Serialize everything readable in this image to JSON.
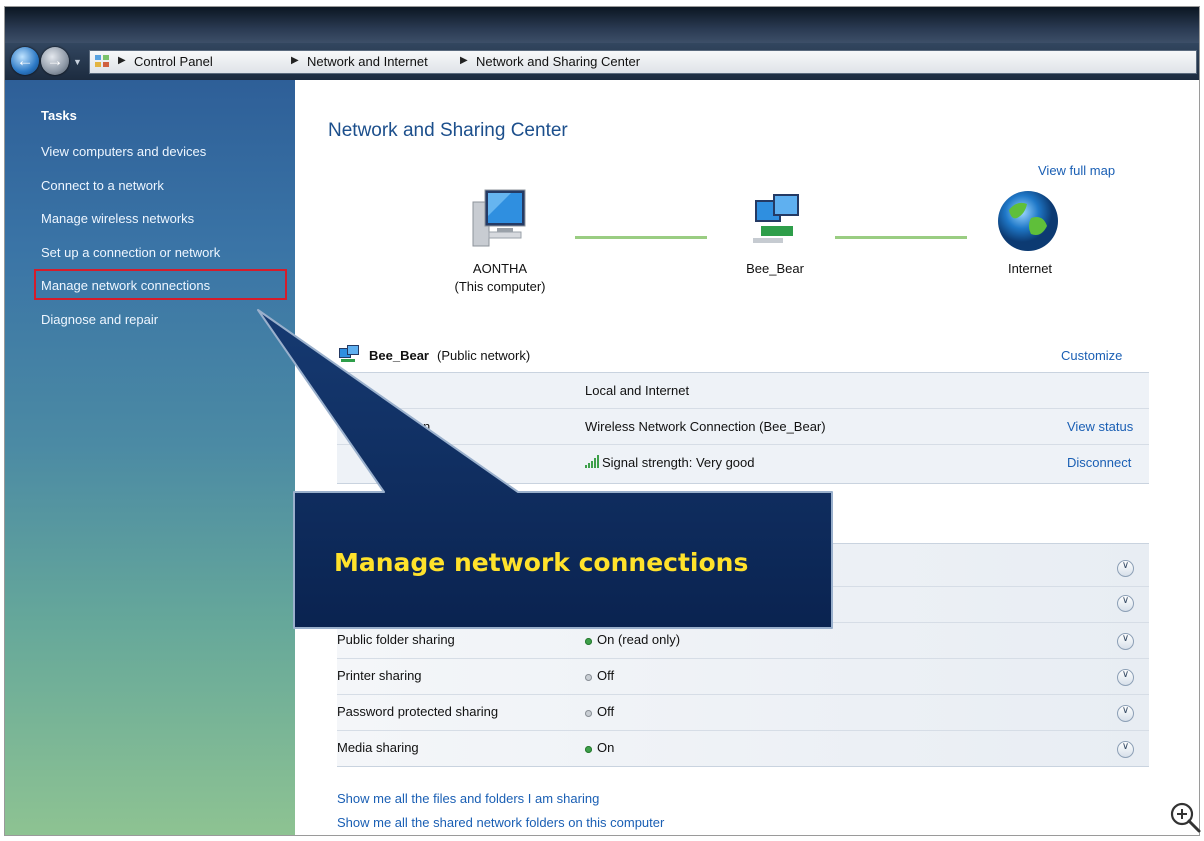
{
  "address_bar": {
    "crumbs": [
      "Control Panel",
      "Network and Internet",
      "Network and Sharing Center"
    ]
  },
  "sidebar": {
    "title": "Tasks",
    "items": [
      "View computers and devices",
      "Connect to a network",
      "Manage wireless networks",
      "Set up a connection or network",
      "Manage network connections",
      "Diagnose and repair"
    ]
  },
  "main": {
    "title": "Network and Sharing Center",
    "view_full_map": "View full map",
    "map": {
      "computer_name": "AONTHA",
      "computer_sub": "(This computer)",
      "network_name": "Bee_Bear",
      "internet": "Internet"
    },
    "network": {
      "name": "Bee_Bear",
      "type": "(Public network)",
      "customize": "Customize",
      "rows": [
        {
          "label": "ss",
          "value": "Local and Internet",
          "action": ""
        },
        {
          "label": "n",
          "value": "Wireless Network Connection (Bee_Bear)",
          "action": "View status"
        },
        {
          "label": "",
          "value": "Signal strength:  Very good",
          "action": "Disconnect"
        }
      ]
    },
    "sharing": {
      "rows": [
        {
          "label": "Public folder sharing",
          "value": "On (read only)",
          "state": "on"
        },
        {
          "label": "Printer sharing",
          "value": "Off",
          "state": "off"
        },
        {
          "label": "Password protected sharing",
          "value": "Off",
          "state": "off"
        },
        {
          "label": "Media sharing",
          "value": "On",
          "state": "on"
        }
      ]
    },
    "links": [
      "Show me all the files and folders I am sharing",
      "Show me all the shared network folders on this computer"
    ]
  },
  "callout": {
    "text": "Manage network connections",
    "color": "#0f2b5a",
    "text_color": "#ffe22b"
  },
  "colors": {
    "accent_link": "#1a5fb4",
    "highlight_border": "#d61c2a"
  }
}
